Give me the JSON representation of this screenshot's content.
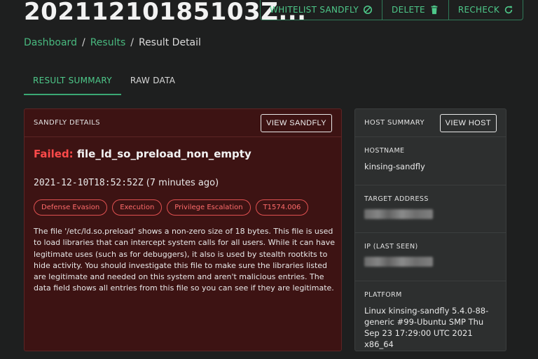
{
  "header": {
    "title": "20211210185103Z...",
    "actions": [
      {
        "label": "WHITELIST SANDFLY",
        "icon": "block-icon"
      },
      {
        "label": "DELETE",
        "icon": "trash-icon"
      },
      {
        "label": "RECHECK",
        "icon": "refresh-icon"
      }
    ]
  },
  "breadcrumb": {
    "items": [
      "Dashboard",
      "Results"
    ],
    "current": "Result Detail",
    "separator": "/"
  },
  "tabs": [
    {
      "label": "RESULT SUMMARY",
      "active": true
    },
    {
      "label": "RAW DATA",
      "active": false
    }
  ],
  "details": {
    "heading": "SANDFLY DETAILS",
    "view_button": "VIEW SANDFLY",
    "status_word": "Failed:",
    "sandfly_name": "file_ld_so_preload_non_empty",
    "timestamp": "2021-12-10T18:52:52Z",
    "relative_time": "(7 minutes ago)",
    "tags": [
      "Defense Evasion",
      "Execution",
      "Privilege Escalation",
      "T1574.006"
    ],
    "description": "The file '/etc/ld.so.preload' shows a non-zero size of 18 bytes. This file is used to load libraries that can intercept system calls for all users. While it can have legitimate uses (such as for debuggers), it also is used by stealth rootkits to hide activity. You should investigate this file to make sure the libraries listed are legitimate and needed on this system and aren't malicious entries. The data field shows all entries from this file so you can see if they are legitimate."
  },
  "host": {
    "heading": "HOST SUMMARY",
    "view_button": "VIEW HOST",
    "hostname_label": "HOSTNAME",
    "hostname": "kinsing-sandfly",
    "target_label": "TARGET ADDRESS",
    "ip_label": "IP (LAST SEEN)",
    "platform_label": "PLATFORM",
    "platform": "Linux kinsing-sandfly 5.4.0-88-generic #99-Ubuntu SMP Thu Sep 23 17:29:00 UTC 2021 x86_64"
  },
  "colors": {
    "accent": "#4ec98a",
    "failed": "#ff4a4a",
    "details_bg": "#3d1313",
    "page_bg": "#1e1f1f"
  }
}
